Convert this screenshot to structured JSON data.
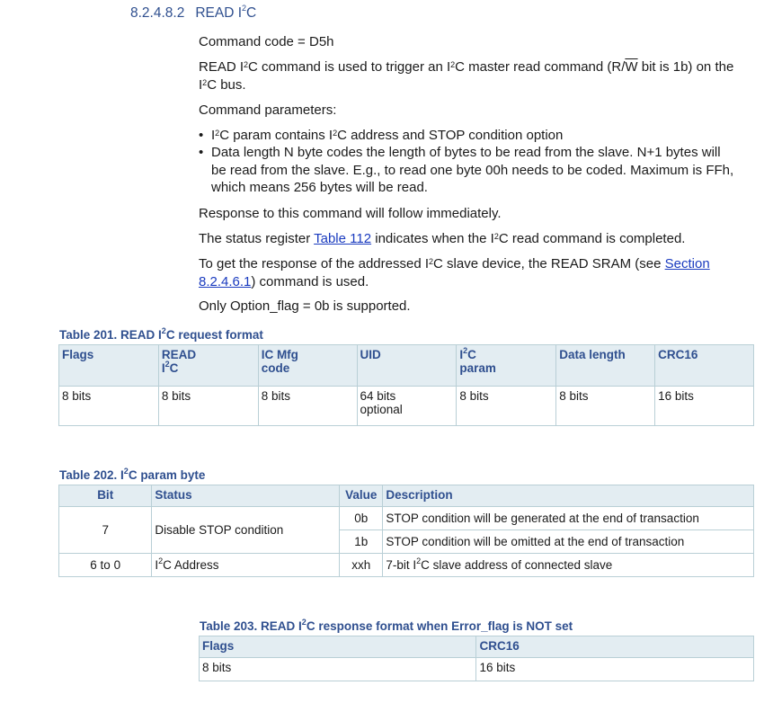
{
  "section": {
    "number": "8.2.4.8.2",
    "title_pre": "READ I",
    "title_sup": "2",
    "title_post": "C"
  },
  "paragraphs": {
    "command_code": "Command code = D5h",
    "desc_a": "READ I",
    "desc_b": "C command is used to trigger an I",
    "desc_c": "C master read command (R/",
    "desc_w": "W",
    "desc_d": " bit is 1b) on the I",
    "desc_e": "C bus.",
    "params_intro": "Command parameters:",
    "bullet1_a": "I",
    "bullet1_b": "C param contains I",
    "bullet1_c": "C address and STOP condition option",
    "bullet2": "Data length N byte codes the length of bytes to be read from the slave. N+1 bytes will be read from the slave. E.g., to read one byte 00h needs to be coded. Maximum is FFh, which means 256 bytes will be read.",
    "response_immediate": "Response to this command will follow immediately.",
    "status_a": "The status register ",
    "status_link": "Table 112",
    "status_b": " indicates when the I",
    "status_c": "C read command is completed.",
    "getresp_a": "To get the response of the addressed I",
    "getresp_b": "C slave device, the READ SRAM (see ",
    "getresp_link": "Section 8.2.4.6.1",
    "getresp_c": ") command is used.",
    "option_flag": "Only Option_flag = 0b is supported.",
    "sup2": "2"
  },
  "table201": {
    "caption_a": "Table 201.  READ I",
    "caption_b": "C request format",
    "headers": [
      "Flags",
      "READ",
      "IC Mfg",
      "UID",
      "I",
      "Data length",
      "CRC16"
    ],
    "headers_line2": [
      "",
      "C",
      "code",
      "",
      "param",
      "",
      ""
    ],
    "cells": [
      "8 bits",
      "8 bits",
      "8 bits",
      "64 bits",
      "8 bits",
      "8 bits",
      "16 bits"
    ],
    "uid_line2": "optional"
  },
  "table202": {
    "caption_a": "Table 202.  I",
    "caption_b": "C param byte",
    "headers": [
      "Bit",
      "Status",
      "Value",
      "Description"
    ],
    "row1": {
      "bit": "7",
      "status": "Disable STOP condition",
      "values": [
        "0b",
        "1b"
      ],
      "descs": [
        "STOP condition will be generated at the end of transaction",
        "STOP condition will be omitted at the end of transaction"
      ]
    },
    "row2": {
      "bit": "6 to 0",
      "status_a": "I",
      "status_b": "C Address",
      "value": "xxh",
      "desc_a": "7-bit I",
      "desc_b": "C slave address of connected slave"
    }
  },
  "table203": {
    "caption_a": "Table 203.  READ I",
    "caption_b": "C response format when Error_flag is NOT set",
    "headers": [
      "Flags",
      "CRC16"
    ],
    "cells": [
      "8 bits",
      "16 bits"
    ]
  }
}
